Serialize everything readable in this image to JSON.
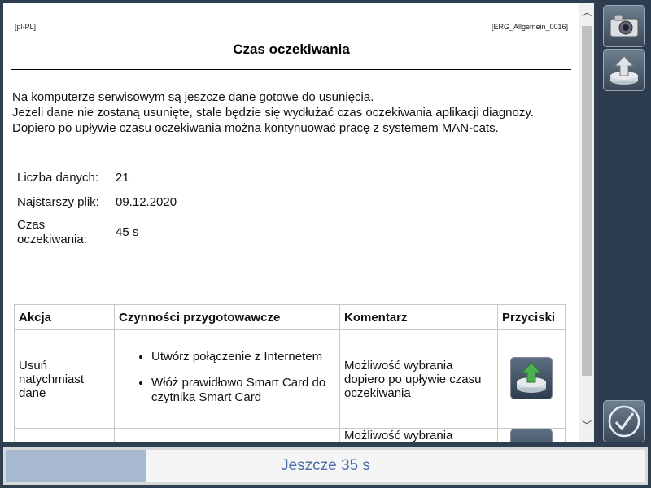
{
  "document": {
    "locale": "[pl-PL]",
    "doc_id": "[ERG_Allgemein_0016]",
    "title": "Czas oczekiwania",
    "intro_lines": [
      "Na komputerze serwisowym są jeszcze dane gotowe do usunięcia.",
      "Jeżeli dane nie zostaną usunięte, stale będzie się wydłużać czas oczekiwania aplikacji diagnozy.",
      "Dopiero po upływie czasu oczekiwania można kontynuować pracę z systemem MAN-cats."
    ],
    "info": {
      "count_label": "Liczba danych:",
      "count_value": "21",
      "oldest_label": "Najstarszy plik:",
      "oldest_value": "09.12.2020",
      "wait_label_1": "Czas",
      "wait_label_2": "oczekiwania:",
      "wait_value": "45 s"
    },
    "table": {
      "headers": [
        "Akcja",
        "Czynności przygotowawcze",
        "Komentarz",
        "Przyciski"
      ],
      "row1": {
        "action_lines": [
          "Usuń",
          "natychmiast",
          "dane"
        ],
        "prep": [
          "Utwórz połączenie z Internetem",
          "Włóż prawidłowo Smart Card do czytnika Smart Card"
        ],
        "comment": "Możliwość wybrania dopiero po upływie czasu oczekiwania"
      },
      "row2": {
        "comment": "Możliwość wybrania"
      }
    }
  },
  "toolbar": {
    "camera_icon": "camera-icon",
    "upload_icon": "upload-drive-icon",
    "confirm_icon": "checkmark-icon"
  },
  "status": {
    "progress_text": "Jeszcze 35 s",
    "progress_fraction": 0.22
  },
  "colors": {
    "progress_fill": "#a7b9cf",
    "progress_text": "#4a6fa5",
    "toolbar_bg": "#2d3c4f",
    "upload_arrow": "#4caf50"
  }
}
